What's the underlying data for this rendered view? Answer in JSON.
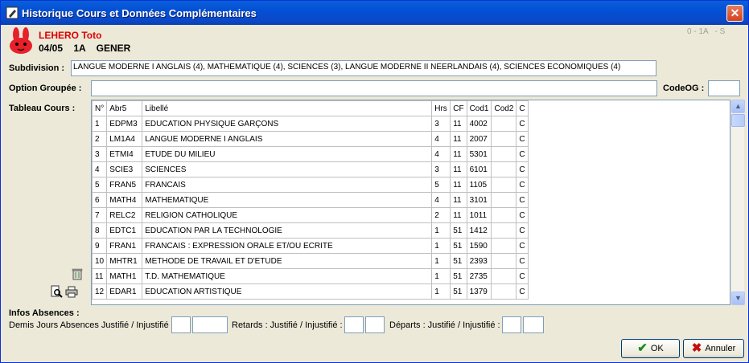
{
  "window": {
    "title": "Historique Cours et Données Complémentaires",
    "close_label": "✕"
  },
  "student": {
    "name": "LEHERO Toto",
    "info1": "04/05",
    "info2": "1A",
    "info3": "GENER",
    "code_top_right": "0 - 1A   - S"
  },
  "subdivision": {
    "label": "Subdivision :",
    "value": "LANGUE MODERNE I ANGLAIS (4), MATHEMATIQUE (4), SCIENCES (3), LANGUE MODERNE II NEERLANDAIS (4), SCIENCES ECONOMIQUES (4)"
  },
  "option": {
    "label": "Option Groupée :",
    "value": "",
    "codeog_label": "CodeOG :",
    "codeog_value": ""
  },
  "tableau": {
    "label": "Tableau Cours :",
    "headers": [
      "N°",
      "Abr5",
      "Libellé",
      "Hrs",
      "CF",
      "Cod1",
      "Cod2",
      "C"
    ],
    "rows": [
      [
        "1",
        "EDPM3",
        "EDUCATION PHYSIQUE GARÇONS",
        "3",
        "11",
        "4002",
        "",
        "C"
      ],
      [
        "2",
        "LM1A4",
        "LANGUE MODERNE I ANGLAIS",
        "4",
        "11",
        "2007",
        "",
        "C"
      ],
      [
        "3",
        "ETMI4",
        "ETUDE DU MILIEU",
        "4",
        "11",
        "5301",
        "",
        "C"
      ],
      [
        "4",
        "SCIE3",
        "SCIENCES",
        "3",
        "11",
        "6101",
        "",
        "C"
      ],
      [
        "5",
        "FRAN5",
        "FRANCAIS",
        "5",
        "11",
        "1105",
        "",
        "C"
      ],
      [
        "6",
        "MATH4",
        "MATHEMATIQUE",
        "4",
        "11",
        "3101",
        "",
        "C"
      ],
      [
        "7",
        "RELC2",
        "RELIGION CATHOLIQUE",
        "2",
        "11",
        "1011",
        "",
        "C"
      ],
      [
        "8",
        "EDTC1",
        "EDUCATION PAR LA TECHNOLOGIE",
        "1",
        "51",
        "1412",
        "",
        "C"
      ],
      [
        "9",
        "FRAN1",
        "FRANCAIS : EXPRESSION ORALE ET/OU ECRITE",
        "1",
        "51",
        "1590",
        "",
        "C"
      ],
      [
        "10",
        "MHTR1",
        "METHODE DE TRAVAIL ET D'ETUDE",
        "1",
        "51",
        "2393",
        "",
        "C"
      ],
      [
        "11",
        "MATH1",
        "T.D. MATHEMATIQUE",
        "1",
        "51",
        "2735",
        "",
        "C"
      ],
      [
        "12",
        "EDAR1",
        "EDUCATION ARTISTIQUE",
        "1",
        "51",
        "1379",
        "",
        "C"
      ]
    ]
  },
  "absences": {
    "heading": "Infos Absences :",
    "demi_label": "Demis Jours Absences Justifié / Injustifié",
    "retards_label": "Retards : Justifié / Injustifié :",
    "departs_label": "Départs : Justifié / Injustifié :"
  },
  "buttons": {
    "ok": "OK",
    "annuler": "Annuler"
  },
  "colors": {
    "title_red": "#e00000",
    "titlebar": "#0350d6",
    "ok_green": "#1a8a1a",
    "cancel_red": "#c01010"
  }
}
